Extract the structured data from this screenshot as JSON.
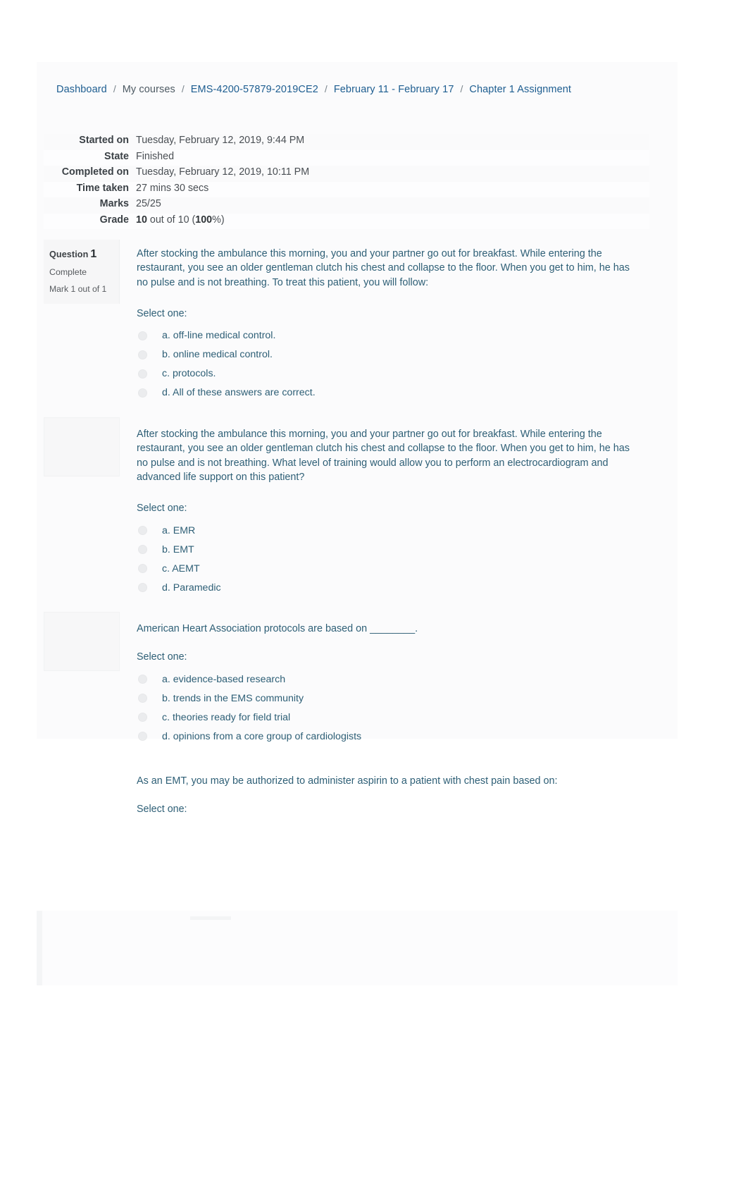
{
  "breadcrumb": {
    "items": [
      {
        "label": "Dashboard",
        "type": "link"
      },
      {
        "label": "My courses",
        "type": "link"
      },
      {
        "label": "EMS-4200-57879-2019CE2",
        "type": "link"
      },
      {
        "label": "February 11 - February 17",
        "type": "link"
      },
      {
        "label": "Chapter 1 Assignment",
        "type": "link"
      }
    ],
    "separator": "/"
  },
  "attempt_info": {
    "rows": [
      {
        "label": "Started on",
        "value": "Tuesday, February 12, 2019, 9:44 PM"
      },
      {
        "label": "State",
        "value": "Finished"
      },
      {
        "label": "Completed on",
        "value": "Tuesday, February 12, 2019, 10:11 PM"
      },
      {
        "label": "Time taken",
        "value": "27 mins 30 secs"
      },
      {
        "label": "Marks",
        "value": "25/25"
      }
    ],
    "grade": {
      "label": "Grade",
      "earned": "10",
      "middle": " out of 10 (",
      "percent": "100",
      "suffix": "%)"
    }
  },
  "select_one_label": "Select one:",
  "questions": [
    {
      "number_label": "Question",
      "number": "1",
      "state": "Complete",
      "mark": "Mark 1 out of 1",
      "text": "After stocking the ambulance this morning, you and your partner go out for breakfast. While entering the restaurant, you see an older gentleman clutch his chest and collapse to the floor. When you get to him, he has no pulse and is not breathing. To treat this patient, you will follow:",
      "options": [
        "a. off-line medical control.",
        "b. online medical control.",
        "c. protocols.",
        "d. All of these answers are correct."
      ]
    },
    {
      "number_label": "",
      "number": "",
      "state": "",
      "mark": "",
      "text": "After stocking the ambulance this morning, you and your partner go out for breakfast. While entering the restaurant, you see an older gentleman clutch his chest and collapse to the floor. When you get to him, he has no pulse and is not breathing. What level of training would allow you to perform an electrocardiogram and advanced life support on this patient?",
      "options": [
        "a. EMR",
        "b. EMT",
        "c. AEMT",
        "d. Paramedic"
      ]
    },
    {
      "number_label": "",
      "number": "",
      "state": "",
      "mark": "",
      "text": "American Heart Association protocols are based on ________.",
      "options": [
        "a. evidence-based research",
        "b. trends in the EMS community",
        "c. theories ready for field trial",
        "d. opinions from a core group of cardiologists"
      ]
    },
    {
      "number_label": "",
      "number": "",
      "state": "",
      "mark": "",
      "text": "As an EMT, you may be authorized to administer aspirin to a patient with chest pain based on:",
      "options": []
    }
  ],
  "colors": {
    "link": "#1d5d90",
    "question_text": "#2e5f76",
    "label": "#3b4146",
    "sheet": "#fbfbfc"
  }
}
